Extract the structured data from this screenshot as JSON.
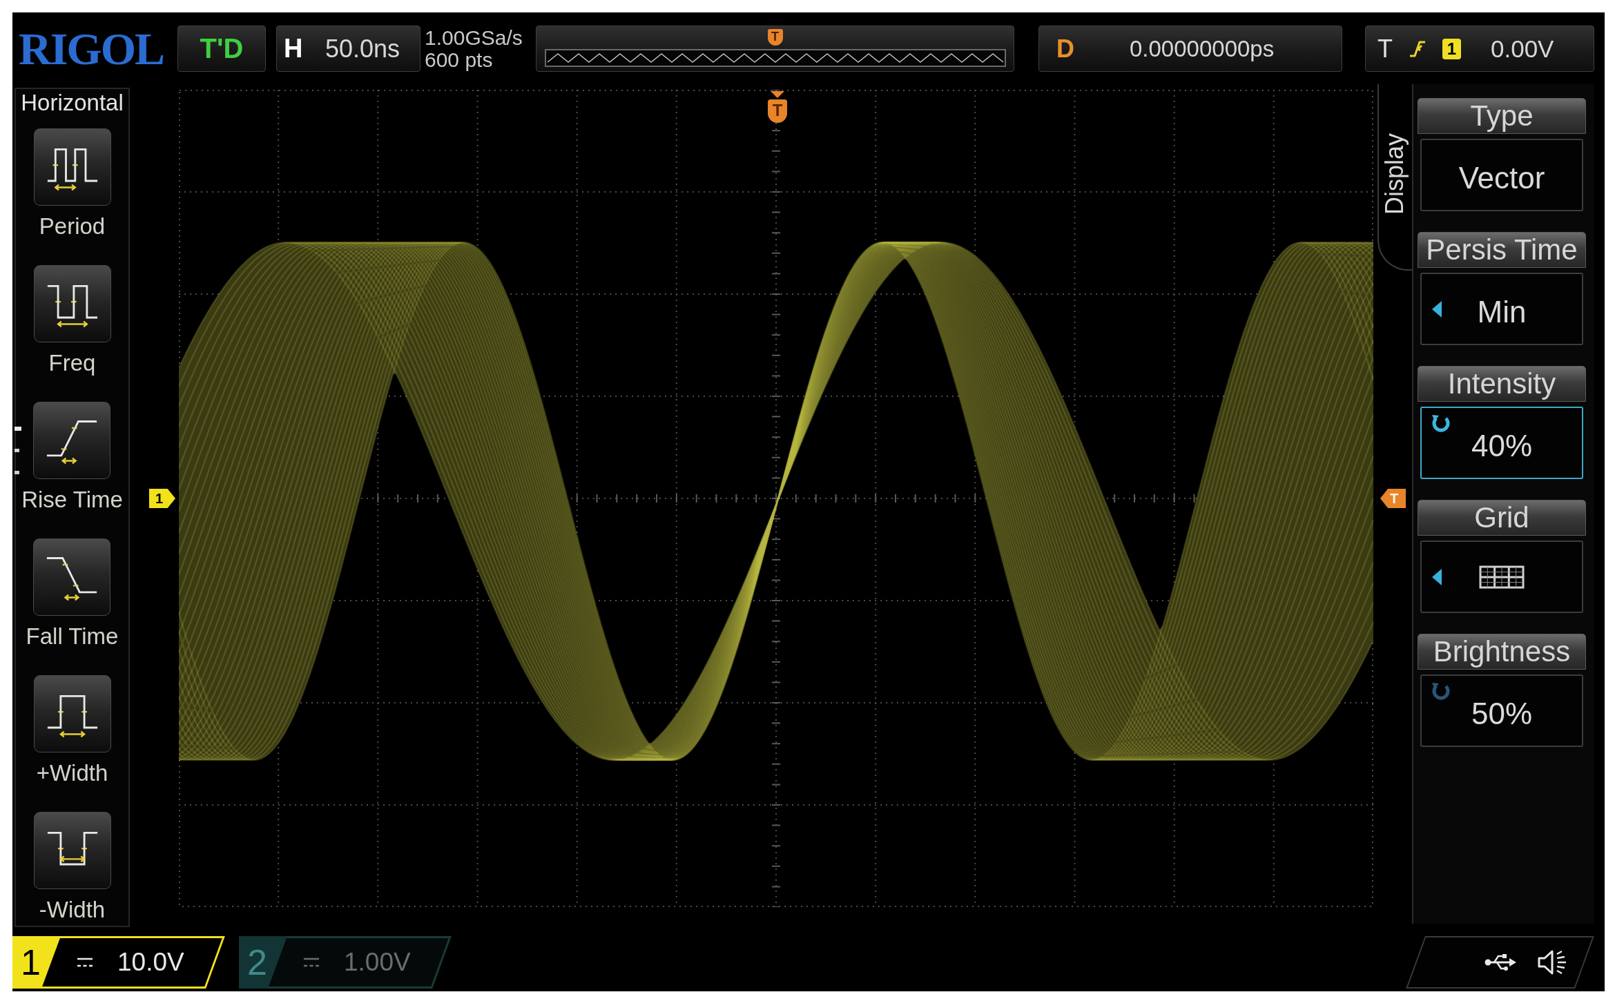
{
  "top_bar": {
    "logo": "RIGOL",
    "run_status": "T'D",
    "timebase": {
      "label": "H",
      "value": "50.0ns"
    },
    "sample_rate": "1.00GSa/s",
    "memory_depth": "600 pts",
    "overview": {
      "trigger_marker": "T"
    },
    "delay": {
      "label": "D",
      "value": "0.00000000ps"
    },
    "trigger": {
      "label": "T",
      "source": "1",
      "level": "0.00V"
    }
  },
  "left_menu": {
    "title": "Horizontal",
    "items": [
      {
        "label": "Period",
        "kind": "period"
      },
      {
        "label": "Freq",
        "kind": "freq"
      },
      {
        "label": "Rise Time",
        "kind": "rise"
      },
      {
        "label": "Fall Time",
        "kind": "fall"
      },
      {
        "label": "+Width",
        "kind": "pwidth"
      },
      {
        "label": "-Width",
        "kind": "nwidth"
      }
    ]
  },
  "display": {
    "trigger_position_marker": "T",
    "channel_marker": "1",
    "trigger_level_marker": "T"
  },
  "right_menu": {
    "tab": "Display",
    "items": [
      {
        "label": "Type",
        "value": "Vector",
        "kind": "plain",
        "selected": false
      },
      {
        "label": "Persis Time",
        "value": "Min",
        "kind": "option",
        "selected": false
      },
      {
        "label": "Intensity",
        "value": "40%",
        "kind": "knob",
        "selected": true
      },
      {
        "label": "Grid",
        "kind": "grid",
        "selected": false
      },
      {
        "label": "Brightness",
        "value": "50%",
        "kind": "knob",
        "selected": false
      }
    ]
  },
  "bottom_bar": {
    "channels": [
      {
        "number": "1",
        "scale": "10.0V",
        "on": true,
        "color": "#f2e21c"
      },
      {
        "number": "2",
        "scale": "1.00V",
        "on": false,
        "color": "#133434"
      }
    ]
  }
}
